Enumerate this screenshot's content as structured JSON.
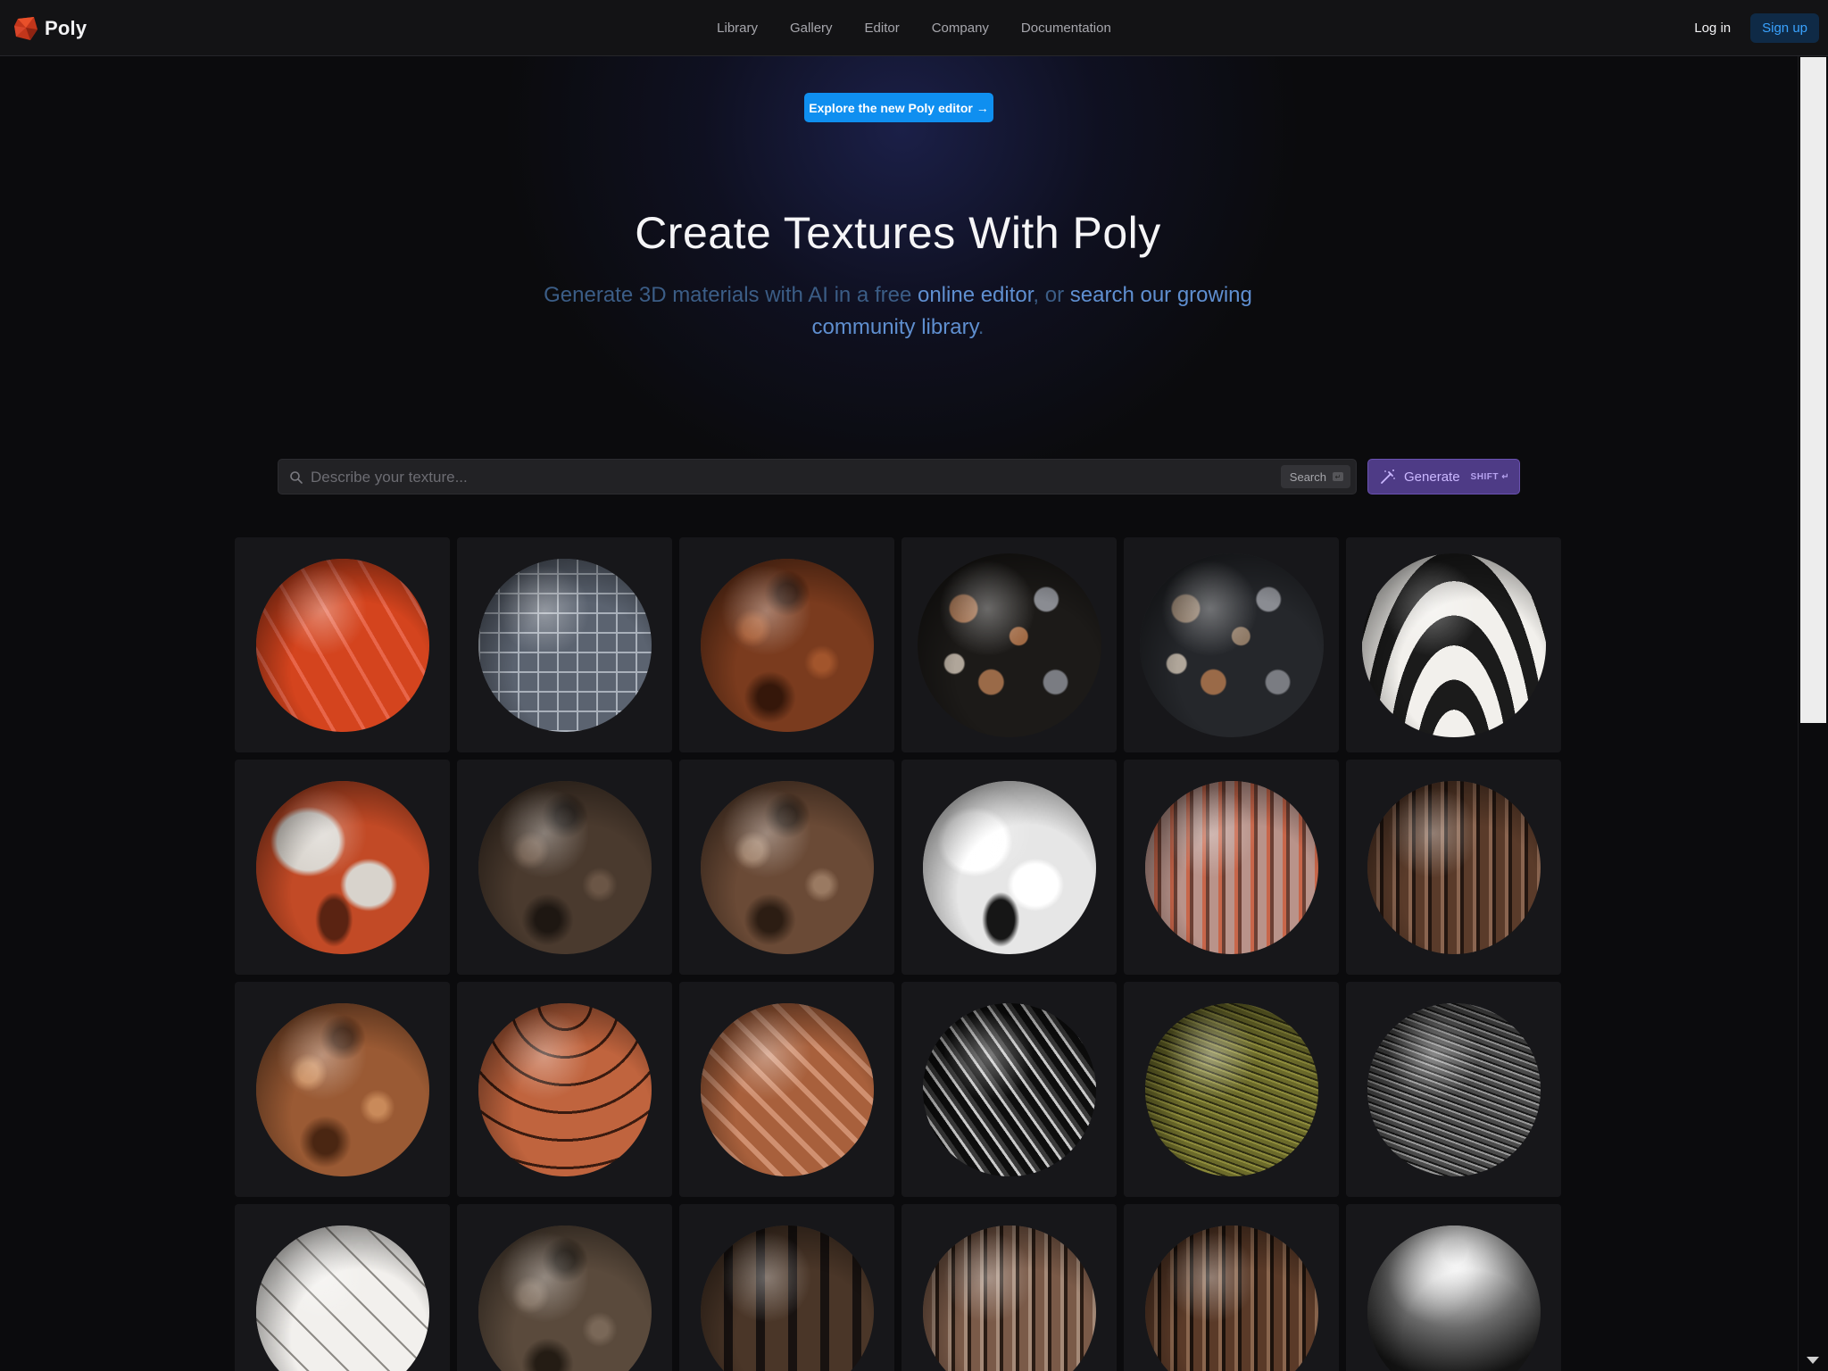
{
  "nav": {
    "brand": "Poly",
    "links": [
      "Library",
      "Gallery",
      "Editor",
      "Company",
      "Documentation"
    ],
    "login": "Log in",
    "signup": "Sign up"
  },
  "hero": {
    "cta": "Explore the new Poly editor →",
    "title": "Create Textures With Poly",
    "subtitle_pre": "Generate 3D materials with AI in a free ",
    "subtitle_link1": "online editor",
    "subtitle_mid": ", or ",
    "subtitle_link2": "search our growing community library",
    "subtitle_post": "."
  },
  "search": {
    "placeholder": "Describe your texture...",
    "button": "Search"
  },
  "generate": {
    "label": "Generate",
    "shortcut": "SHIFT ↵"
  },
  "colors": {
    "accent_blue": "#0f8ff0",
    "generate_purple": "#4e3b86",
    "background": "#0b0b0d"
  },
  "materials": [
    {
      "name": "orange-white-streaked",
      "base": "#d4441e",
      "mid": "#e8664a",
      "dark": "#7a1d08",
      "pattern": "stripes"
    },
    {
      "name": "glass-tile",
      "base": "#5b6370",
      "mid": "#a9b0ba",
      "dark": "#23272e",
      "pattern": "grid"
    },
    {
      "name": "brown-leather",
      "base": "#7a3b1e",
      "mid": "#a2552c",
      "dark": "#35170a",
      "pattern": "noise"
    },
    {
      "name": "pebble-mosaic-dark",
      "base": "#4a4540",
      "mid": "#a06a45",
      "dark": "#1c1a18",
      "pattern": "pebbles"
    },
    {
      "name": "pebble-mosaic-blue",
      "base": "#5b5d63",
      "mid": "#8f7a66",
      "dark": "#25272b",
      "pattern": "pebbles"
    },
    {
      "name": "black-white-mosaic",
      "base": "#d9d7d2",
      "mid": "#f2f0ec",
      "dark": "#1b1b1b",
      "pattern": "waves"
    },
    {
      "name": "peeling-orange-paint",
      "base": "#c24a26",
      "mid": "#d8d3cc",
      "dark": "#5a2312",
      "pattern": "patches"
    },
    {
      "name": "dark-rock",
      "base": "#4a3a2e",
      "mid": "#6b5646",
      "dark": "#1e1712",
      "pattern": "noise"
    },
    {
      "name": "brown-rock-cliff",
      "base": "#6a4a36",
      "mid": "#9a7a62",
      "dark": "#2c1d13",
      "pattern": "noise"
    },
    {
      "name": "white-black-cow",
      "base": "#e6e6e6",
      "mid": "#ffffff",
      "dark": "#161616",
      "pattern": "patches"
    },
    {
      "name": "striped-fabric",
      "base": "#b9938a",
      "mid": "#c8664a",
      "dark": "#6b3f33",
      "pattern": "vstripes"
    },
    {
      "name": "bark-ridged",
      "base": "#5a3b2a",
      "mid": "#8a6550",
      "dark": "#231610",
      "pattern": "vstripes"
    },
    {
      "name": "coconut-fiber",
      "base": "#9a5a34",
      "mid": "#c98a5a",
      "dark": "#4a2612",
      "pattern": "noise"
    },
    {
      "name": "terracotta-tiles",
      "base": "#c0643e",
      "mid": "#dd8a66",
      "dark": "#3a1b10",
      "pattern": "arches"
    },
    {
      "name": "woven-wood",
      "base": "#a8603c",
      "mid": "#d09070",
      "dark": "#5a2c16",
      "pattern": "weave"
    },
    {
      "name": "carbon-fiber",
      "base": "#3a3a3a",
      "mid": "#c9c9c9",
      "dark": "#0e0e0e",
      "pattern": "diag"
    },
    {
      "name": "moss-grass",
      "base": "#6b6a2a",
      "mid": "#8e8c3c",
      "dark": "#2e2d12",
      "pattern": "hlines"
    },
    {
      "name": "grey-shingles",
      "base": "#4a4a4a",
      "mid": "#9a9a9a",
      "dark": "#161616",
      "pattern": "hlines"
    },
    {
      "name": "white-quilted-leather",
      "base": "#d8d6d2",
      "mid": "#f2f0ed",
      "dark": "#8e8b86",
      "pattern": "quilt"
    },
    {
      "name": "dark-dirt",
      "base": "#5a4a3c",
      "mid": "#7a6858",
      "dark": "#241c14",
      "pattern": "noise"
    },
    {
      "name": "old-wood-beams",
      "base": "#4a3628",
      "mid": "#7a5a44",
      "dark": "#181210",
      "pattern": "beams"
    },
    {
      "name": "cracked-bark",
      "base": "#7a5a48",
      "mid": "#a58a78",
      "dark": "#2a1c14",
      "pattern": "vstripes"
    },
    {
      "name": "hairy-bark",
      "base": "#5a3a28",
      "mid": "#8a664e",
      "dark": "#1c120c",
      "pattern": "vstripes"
    },
    {
      "name": "chrome",
      "base": "#6a6a6a",
      "mid": "#dcdcdc",
      "dark": "#141414",
      "pattern": "chrome"
    }
  ]
}
